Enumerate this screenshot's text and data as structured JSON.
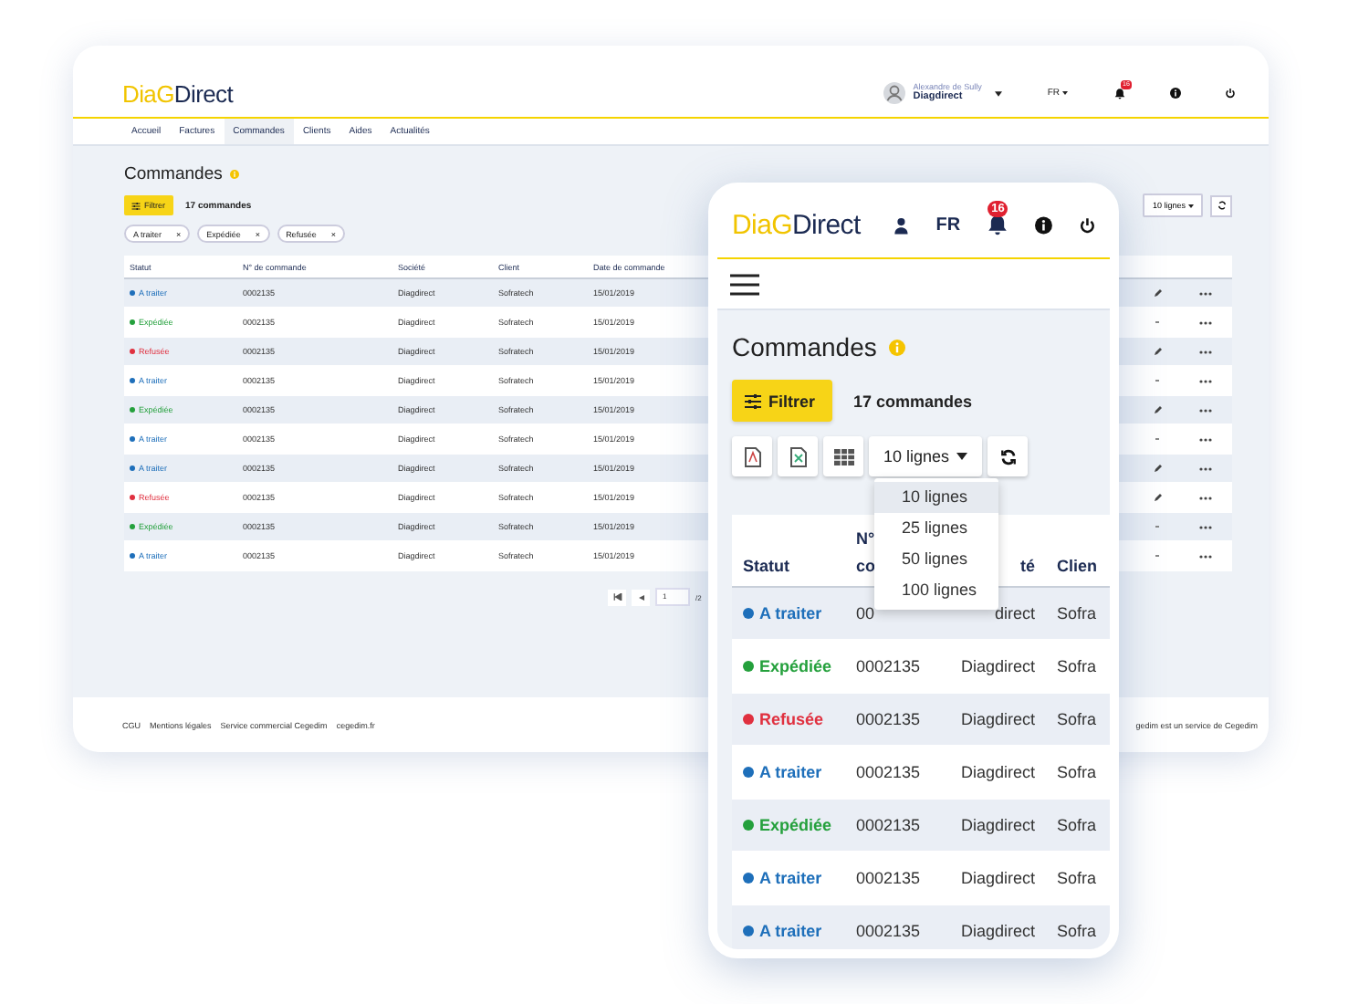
{
  "desktop": {
    "logo": {
      "first": "DiaG",
      "second": "Direct"
    },
    "user": {
      "name": "Alexandre de Sully",
      "company": "Diagdirect"
    },
    "language": "FR",
    "notifications": "16",
    "nav": [
      {
        "label": "Accueil",
        "selected": false
      },
      {
        "label": "Factures",
        "selected": false
      },
      {
        "label": "Commandes",
        "selected": true
      },
      {
        "label": "Clients",
        "selected": false
      },
      {
        "label": "Aides",
        "selected": false
      },
      {
        "label": "Actualités",
        "selected": false
      }
    ],
    "page_title": "Commandes",
    "filter_button": "Filtrer",
    "count": "17 commandes",
    "page_size": "10 lignes",
    "filter_chips": [
      {
        "label": "A traiter",
        "remove": "×"
      },
      {
        "label": "Expédiée",
        "remove": "×"
      },
      {
        "label": "Refusée",
        "remove": "×"
      }
    ],
    "table": {
      "columns": [
        "Statut",
        "N° de commande",
        "Société",
        "Client",
        "Date de commande"
      ],
      "rows": [
        {
          "status": "A traiter",
          "kind": "todo",
          "number": "0002135",
          "company": "Diagdirect",
          "client": "Sofratech",
          "date": "15/01/2019",
          "editable": true
        },
        {
          "status": "Expédiée",
          "kind": "shipped",
          "number": "0002135",
          "company": "Diagdirect",
          "client": "Sofratech",
          "date": "15/01/2019",
          "editable": false
        },
        {
          "status": "Refusée",
          "kind": "refused",
          "number": "0002135",
          "company": "Diagdirect",
          "client": "Sofratech",
          "date": "15/01/2019",
          "editable": true
        },
        {
          "status": "A traiter",
          "kind": "todo",
          "number": "0002135",
          "company": "Diagdirect",
          "client": "Sofratech",
          "date": "15/01/2019",
          "editable": false
        },
        {
          "status": "Expédiée",
          "kind": "shipped",
          "number": "0002135",
          "company": "Diagdirect",
          "client": "Sofratech",
          "date": "15/01/2019",
          "editable": true
        },
        {
          "status": "A traiter",
          "kind": "todo",
          "number": "0002135",
          "company": "Diagdirect",
          "client": "Sofratech",
          "date": "15/01/2019",
          "editable": false
        },
        {
          "status": "A traiter",
          "kind": "todo",
          "number": "0002135",
          "company": "Diagdirect",
          "client": "Sofratech",
          "date": "15/01/2019",
          "editable": true
        },
        {
          "status": "Refusée",
          "kind": "refused",
          "number": "0002135",
          "company": "Diagdirect",
          "client": "Sofratech",
          "date": "15/01/2019",
          "editable": true
        },
        {
          "status": "Expédiée",
          "kind": "shipped",
          "number": "0002135",
          "company": "Diagdirect",
          "client": "Sofratech",
          "date": "15/01/2019",
          "editable": false
        },
        {
          "status": "A traiter",
          "kind": "todo",
          "number": "0002135",
          "company": "Diagdirect",
          "client": "Sofratech",
          "date": "15/01/2019",
          "editable": false
        }
      ]
    },
    "pagination": {
      "page": "1",
      "total": "/2"
    },
    "footer_links": [
      "CGU",
      "Mentions légales",
      "Service commercial Cegedim",
      "cegedim.fr"
    ],
    "footer_note": "gedim est un service de Cegedim"
  },
  "mobile": {
    "logo": {
      "first": "DiaG",
      "second": "Direct"
    },
    "language": "FR",
    "notifications": "16",
    "page_title": "Commandes",
    "filter_button": "Filtrer",
    "count": "17 commandes",
    "page_size": "10 lignes",
    "page_size_menu": [
      {
        "label": "10 lignes",
        "selected": true
      },
      {
        "label": "25 lignes",
        "selected": false
      },
      {
        "label": "50 lignes",
        "selected": false
      },
      {
        "label": "100 lignes",
        "selected": false
      }
    ],
    "table": {
      "columns": [
        "Statut",
        "N°\nco",
        "té",
        "Clien"
      ],
      "rows": [
        {
          "status": "A traiter",
          "kind": "todo",
          "number": "00",
          "company": "direct",
          "client": "Sofra"
        },
        {
          "status": "Expédiée",
          "kind": "shipped",
          "number": "0002135",
          "company": "Diagdirect",
          "client": "Sofra"
        },
        {
          "status": "Refusée",
          "kind": "refused",
          "number": "0002135",
          "company": "Diagdirect",
          "client": "Sofra"
        },
        {
          "status": "A traiter",
          "kind": "todo",
          "number": "0002135",
          "company": "Diagdirect",
          "client": "Sofra"
        },
        {
          "status": "Expédiée",
          "kind": "shipped",
          "number": "0002135",
          "company": "Diagdirect",
          "client": "Sofra"
        },
        {
          "status": "A traiter",
          "kind": "todo",
          "number": "0002135",
          "company": "Diagdirect",
          "client": "Sofra"
        },
        {
          "status": "A traiter",
          "kind": "todo",
          "number": "0002135",
          "company": "Diagdirect",
          "client": "Sofra"
        }
      ]
    }
  }
}
